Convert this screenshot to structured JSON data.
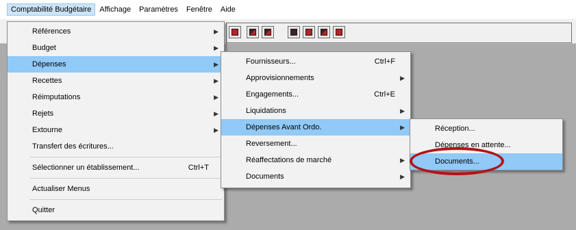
{
  "menubar": {
    "items": [
      {
        "label": "Comptabilité Budgétaire"
      },
      {
        "label": "Affichage"
      },
      {
        "label": "Paramètres"
      },
      {
        "label": "Fenêtre"
      },
      {
        "label": "Aide"
      }
    ]
  },
  "toolbar": {
    "buttons": [
      {
        "icon": "document-red-icon"
      },
      {
        "icon": "document-copy-icon"
      },
      {
        "icon": "document-copy-icon"
      },
      {
        "icon": "grid-red-icon"
      },
      {
        "icon": "grid-red-icon"
      },
      {
        "icon": "grid-red-icon"
      },
      {
        "icon": "grid-red-icon"
      }
    ]
  },
  "menu1": {
    "items": [
      {
        "label": "Références",
        "submenu": true
      },
      {
        "label": "Budget",
        "submenu": true
      },
      {
        "label": "Dépenses",
        "submenu": true,
        "highlighted": true
      },
      {
        "label": "Recettes",
        "submenu": true
      },
      {
        "label": "Réimputations",
        "submenu": true
      },
      {
        "label": "Rejets",
        "submenu": true
      },
      {
        "label": "Extourne",
        "submenu": true
      },
      {
        "label": "Transfert des écritures..."
      },
      {
        "label": "Sélectionner un établissement...",
        "shortcut": "Ctrl+T"
      },
      {
        "label": "Actualiser Menus"
      },
      {
        "label": "Quitter"
      }
    ]
  },
  "menu2": {
    "items": [
      {
        "label": "Fournisseurs...",
        "shortcut": "Ctrl+F"
      },
      {
        "label": "Approvisionnements",
        "submenu": true
      },
      {
        "label": "Engagements...",
        "shortcut": "Ctrl+E"
      },
      {
        "label": "Liquidations",
        "submenu": true
      },
      {
        "label": "Dépenses Avant Ordo.",
        "submenu": true,
        "highlighted": true
      },
      {
        "label": "Reversement..."
      },
      {
        "label": "Réaffectations de marché",
        "submenu": true
      },
      {
        "label": "Documents",
        "submenu": true
      }
    ]
  },
  "menu3": {
    "items": [
      {
        "label": "Réception..."
      },
      {
        "label": "Dépenses en attente..."
      },
      {
        "label": "Documents...",
        "highlighted": true
      }
    ]
  },
  "annotation": {
    "color": "#b31217"
  },
  "colors": {
    "menu_highlight": "#91c9f7",
    "workspace": "#ababab",
    "menu_bg": "#f2f2f2"
  }
}
